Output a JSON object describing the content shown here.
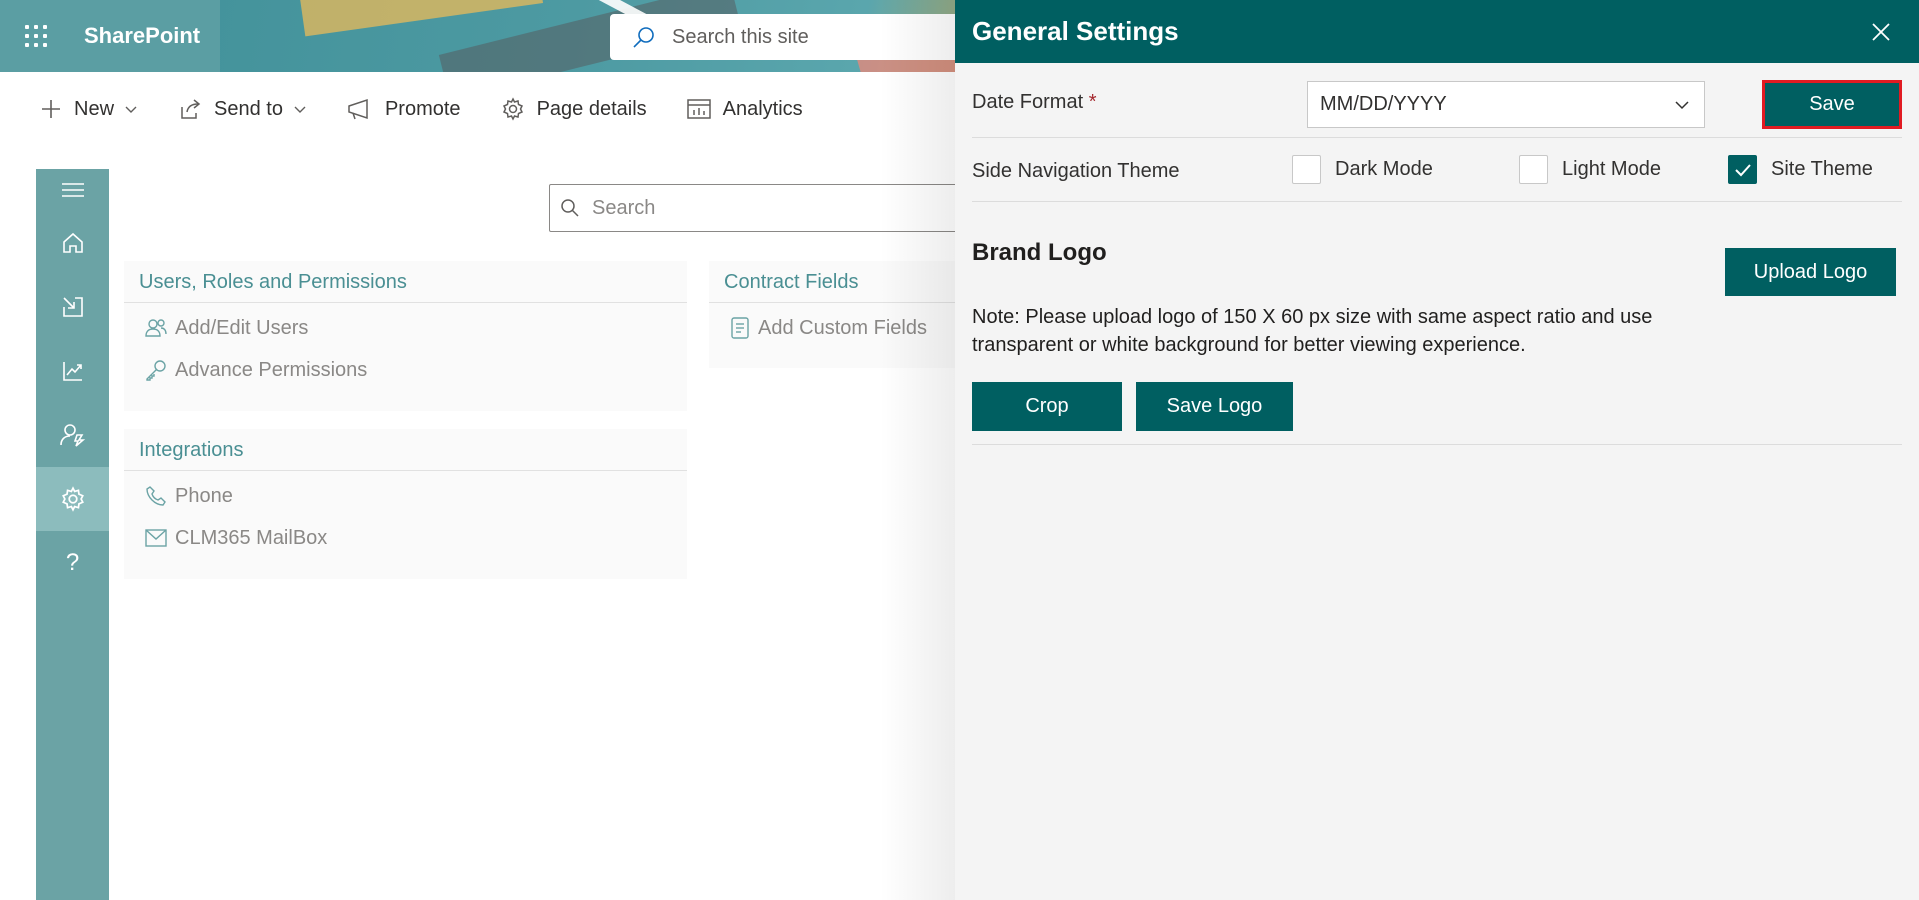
{
  "suitebar": {
    "app_name": "SharePoint",
    "search_placeholder": "Search this site"
  },
  "commandbar": {
    "new_label": "New",
    "send_to_label": "Send to",
    "promote_label": "Promote",
    "page_details_label": "Page details",
    "analytics_label": "Analytics"
  },
  "rail": {
    "items": [
      "menu-icon",
      "home-icon",
      "import-icon",
      "chart-icon",
      "user-settings-icon",
      "gear-icon",
      "help-icon"
    ],
    "help_glyph": "?",
    "active_index": 5
  },
  "main": {
    "search_placeholder": "Search",
    "cards": {
      "users": {
        "title": "Users, Roles and Permissions",
        "items": [
          "Add/Edit Users",
          "Advance Permissions"
        ]
      },
      "contract": {
        "title": "Contract Fields",
        "items": [
          "Add Custom Fields"
        ]
      },
      "integrations": {
        "title": "Integrations",
        "items": [
          "Phone",
          "CLM365 MailBox"
        ]
      }
    }
  },
  "panel": {
    "title": "General Settings",
    "date_format": {
      "label": "Date Format",
      "required_mark": "*",
      "value": "MM/DD/YYYY"
    },
    "save_label": "Save",
    "theme": {
      "label": "Side Navigation Theme",
      "options": [
        {
          "label": "Dark Mode",
          "checked": false
        },
        {
          "label": "Light Mode",
          "checked": false
        },
        {
          "label": "Site Theme",
          "checked": true
        }
      ]
    },
    "brand": {
      "title": "Brand Logo",
      "upload_label": "Upload Logo",
      "note": "Note: Please upload logo of 150 X 60 px size with same aspect ratio and use transparent or white background for better viewing experience.",
      "crop_label": "Crop",
      "save_logo_label": "Save Logo"
    }
  },
  "colors": {
    "primary": "#005f61",
    "rail": "#6ba3a5",
    "highlight_border": "#e11b22",
    "link": "#4a8f93"
  }
}
